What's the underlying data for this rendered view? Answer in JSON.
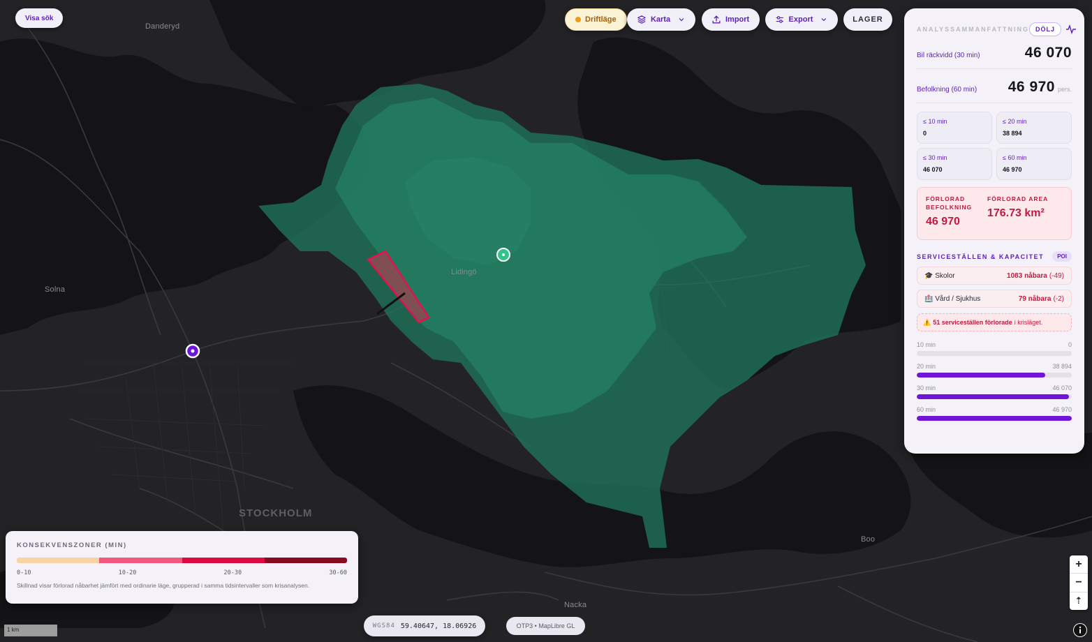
{
  "toolbar": {
    "visa_sok": "Visa sök",
    "driftlage": "Driftläge",
    "karta": "Karta",
    "import": "Import",
    "export": "Export",
    "lager": "LAGER"
  },
  "map": {
    "labels": {
      "danderyd": "Danderyd",
      "solna": "Solna",
      "lidingo": "Lidingö",
      "stockholm": "STOCKHOLM",
      "nacka": "Nacka",
      "boo": "Boo"
    },
    "colors": {
      "background": "#222224",
      "water": "#131315",
      "isochrone": "#1f7a5e",
      "closure": "#e0134f",
      "origin": "#2fc58a",
      "marker": "#7014d8"
    }
  },
  "panel": {
    "title": "ANALYSSAMMANFATTNING",
    "hide_label": "DÖLJ",
    "car_reach_label": "Bil räckvidd (30 min)",
    "car_reach_value": "46 070",
    "population_label": "Befolkning (60 min)",
    "population_value": "46 970",
    "population_unit": "pers.",
    "cells": [
      {
        "label": "≤ 10 min",
        "value": "0"
      },
      {
        "label": "≤ 20 min",
        "value": "38 894"
      },
      {
        "label": "≤ 30 min",
        "value": "46 070"
      },
      {
        "label": "≤ 60 min",
        "value": "46 970"
      }
    ],
    "lost_population_label_1": "FÖRLORAD",
    "lost_population_label_2": "BEFOLKNING",
    "lost_population_value": "46 970",
    "lost_area_label": "FÖRLORAD AREA",
    "lost_area_value": "176.73 km²",
    "services_title": "SERVICESTÄLLEN & KAPACITET",
    "poi_label": "POI",
    "services": [
      {
        "icon": "🎓",
        "name": "Skolor",
        "reach": "1083 nåbara",
        "delta": "(-49)"
      },
      {
        "icon": "🏥",
        "name": "Vård / Sjukhus",
        "reach": "79 nåbara",
        "delta": "(-2)"
      }
    ],
    "warning_icon": "⚠️",
    "warning_bold": "51 serviceställen förlorade",
    "warning_rest": "i krisläget.",
    "bars": [
      {
        "label": "10 min",
        "value": "0",
        "fraction": 0
      },
      {
        "label": "20 min",
        "value": "38 894",
        "fraction": 0.83
      },
      {
        "label": "30 min",
        "value": "46 070",
        "fraction": 0.98
      },
      {
        "label": "60 min",
        "value": "46 970",
        "fraction": 1.0
      }
    ]
  },
  "legend": {
    "title": "KONSEKVENSZONER (MIN)",
    "colors": [
      "#f8d3a4",
      "#f2577d",
      "#dc0a40",
      "#8a0a22"
    ],
    "ticks": [
      "0-10",
      "10-20",
      "20-30",
      "30-60"
    ],
    "note": "Skillnad visar förlorad nåbarhet jämfört med ordinarie läge, grupperad i samma tidsintervaller som krisanalysen."
  },
  "footer": {
    "crs": "WGS84",
    "coordinates": "59.40647, 18.06926",
    "attribution": "OTP3 • MapLibre GL",
    "scale": "1 km"
  },
  "zoom": {
    "in": "+",
    "out": "−",
    "north": "⇡"
  }
}
